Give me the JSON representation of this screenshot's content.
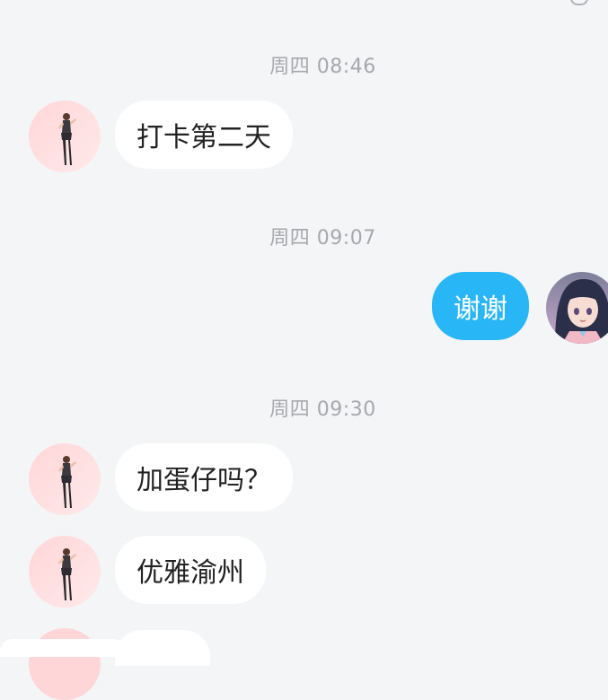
{
  "colors": {
    "background": "#f4f5f7",
    "timestamp_text": "#a6a8ad",
    "incoming_bubble": "#ffffff",
    "outgoing_bubble": "#29b6f6",
    "incoming_text": "#222222",
    "outgoing_text": "#ffffff"
  },
  "timestamps": {
    "t1": "周四 08:46",
    "t2": "周四 09:07",
    "t3": "周四 09:30"
  },
  "messages": [
    {
      "side": "left",
      "text": "打卡第二天",
      "avatar_icon": "dancer-avatar-icon"
    },
    {
      "side": "right",
      "text": "谢谢",
      "avatar_icon": "anime-girl-avatar-icon"
    },
    {
      "side": "left",
      "text": "加蛋仔吗？",
      "avatar_icon": "dancer-avatar-icon"
    },
    {
      "side": "left",
      "text": "优雅渝州",
      "avatar_icon": "dancer-avatar-icon"
    }
  ]
}
